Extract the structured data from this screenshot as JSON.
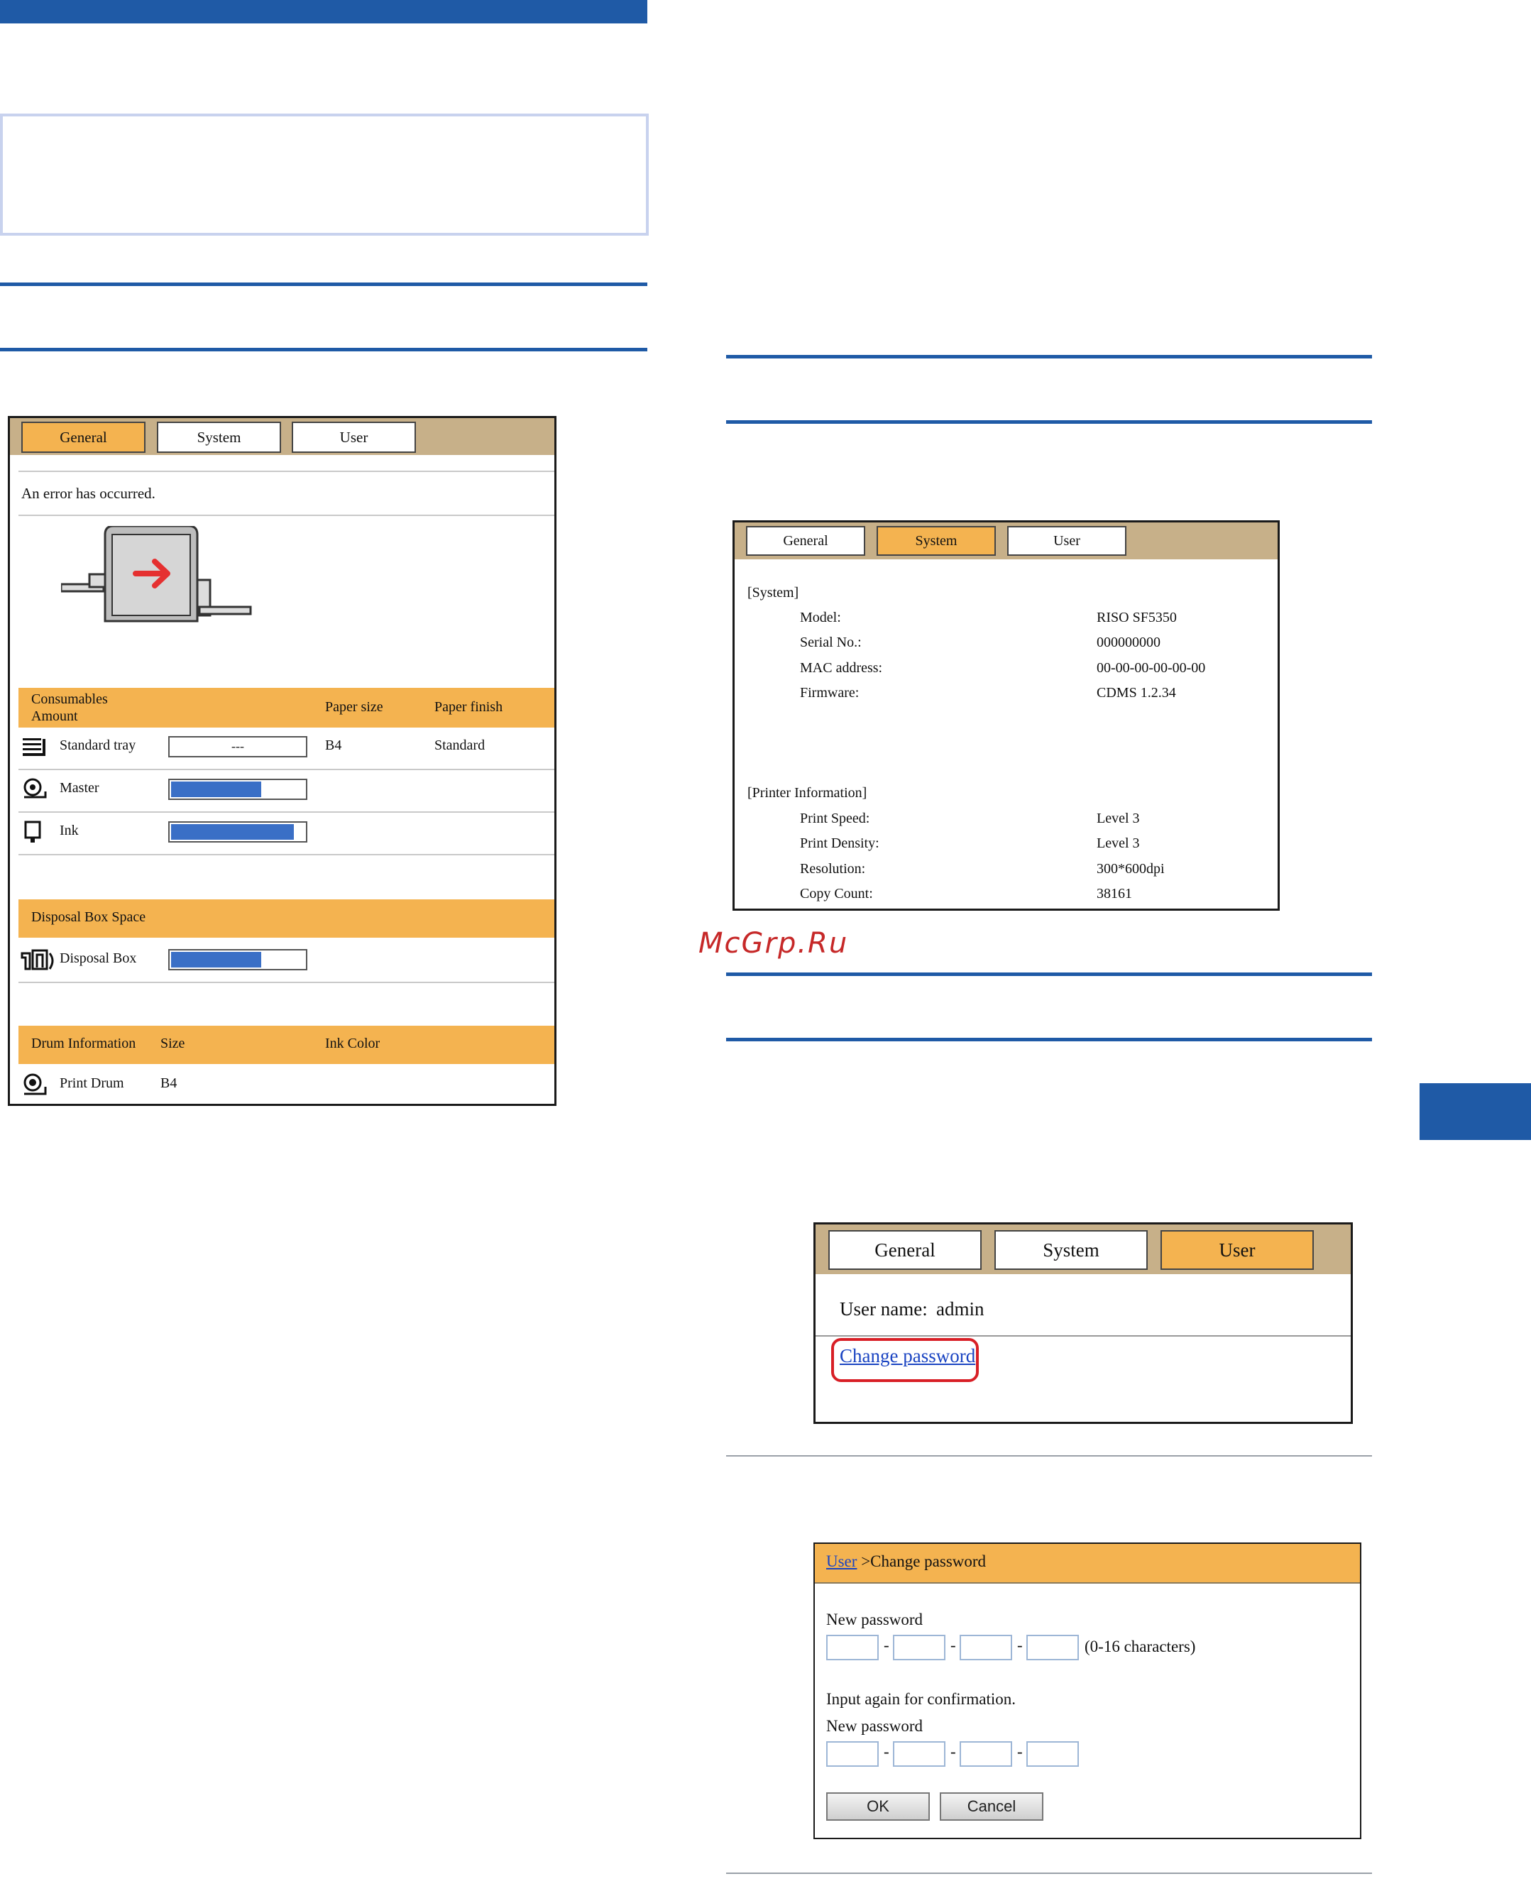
{
  "watermark": "McGrp.Ru",
  "general_panel": {
    "tabs": [
      {
        "label": "General",
        "active": true
      },
      {
        "label": "System",
        "active": false
      },
      {
        "label": "User",
        "active": false
      }
    ],
    "status_message": "An error has occurred.",
    "consumables_header": {
      "col1": "Consumables\nAmount",
      "col2": "Paper size",
      "col3": "Paper finish"
    },
    "standard_tray": {
      "label": "Standard tray",
      "value": "---",
      "paper_size": "B4",
      "paper_finish": "Standard"
    },
    "master": {
      "label": "Master",
      "level": 0.68
    },
    "ink": {
      "label": "Ink",
      "level": 0.92
    },
    "disposal_header": "Disposal Box Space",
    "disposal_box": {
      "label": "Disposal Box",
      "level": 0.68
    },
    "drum_header": {
      "col1": "Drum Information",
      "col2": "Size",
      "col3": "Ink Color"
    },
    "print_drum": {
      "label": "Print Drum",
      "size": "B4"
    },
    "colors": {
      "tabbar": "#c7b089",
      "header": "#f4b350",
      "meter": "#3a6fc6"
    }
  },
  "system_panel": {
    "tabs": [
      {
        "label": "General",
        "active": false
      },
      {
        "label": "System",
        "active": true
      },
      {
        "label": "User",
        "active": false
      }
    ],
    "system_section": "[System]",
    "system_rows": [
      {
        "label": "Model:",
        "value": "RISO SF5350"
      },
      {
        "label": "Serial No.:",
        "value": "000000000"
      },
      {
        "label": "MAC address:",
        "value": "00-00-00-00-00-00"
      },
      {
        "label": "Firmware:",
        "value": "CDMS 1.2.34"
      }
    ],
    "printer_section": "[Printer Information]",
    "printer_rows": [
      {
        "label": "Print Speed:",
        "value": "Level 3"
      },
      {
        "label": "Print Density:",
        "value": "Level 3"
      },
      {
        "label": "Resolution:",
        "value": "300*600dpi"
      },
      {
        "label": "Copy Count:",
        "value": "38161"
      }
    ]
  },
  "user_panel": {
    "tabs": [
      {
        "label": "General",
        "active": false
      },
      {
        "label": "System",
        "active": false
      },
      {
        "label": "User",
        "active": true
      }
    ],
    "user_name_label": "User name:",
    "user_name_value": "admin",
    "change_password_link": "Change password"
  },
  "password_panel": {
    "breadcrumb_link": "User",
    "breadcrumb_rest": " >Change password",
    "new_password_label": "New password",
    "char_hint": "(0-16 characters)",
    "separator": "-",
    "confirm_label": "Input again for confirmation.",
    "confirm_password_label": "New password",
    "ok_label": "OK",
    "cancel_label": "Cancel"
  }
}
